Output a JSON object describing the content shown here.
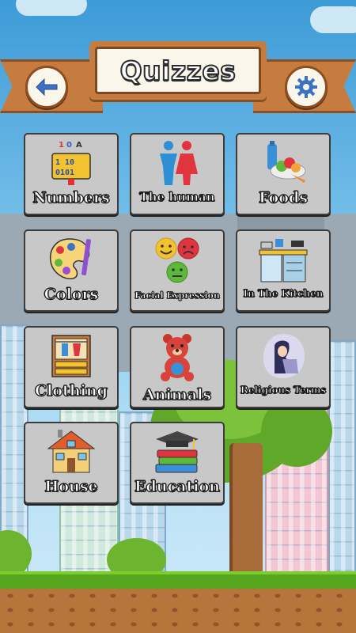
{
  "header": {
    "title": "Quizzes",
    "back_icon": "back-arrow-icon",
    "settings_icon": "gear-icon"
  },
  "tiles": [
    {
      "label": "Numbers",
      "icon": "numbers-icon"
    },
    {
      "label": "The human",
      "icon": "human-icon"
    },
    {
      "label": "Foods",
      "icon": "foods-icon"
    },
    {
      "label": "Colors",
      "icon": "palette-icon"
    },
    {
      "label": "Facial Expression",
      "icon": "faces-icon"
    },
    {
      "label": "In The Kitchen",
      "icon": "kitchen-icon"
    },
    {
      "label": "Clothing",
      "icon": "wardrobe-icon"
    },
    {
      "label": "Animals",
      "icon": "teddy-bear-icon"
    },
    {
      "label": "Religious Terms",
      "icon": "praying-figure-icon"
    },
    {
      "label": "House",
      "icon": "house-icon"
    },
    {
      "label": "Education",
      "icon": "books-graduation-cap-icon"
    }
  ],
  "colors": {
    "sky": "#3d9bd6",
    "ribbon": "#c67c3f",
    "tile_bg": "#c8c8c8",
    "accent_blue": "#3b72c4"
  }
}
